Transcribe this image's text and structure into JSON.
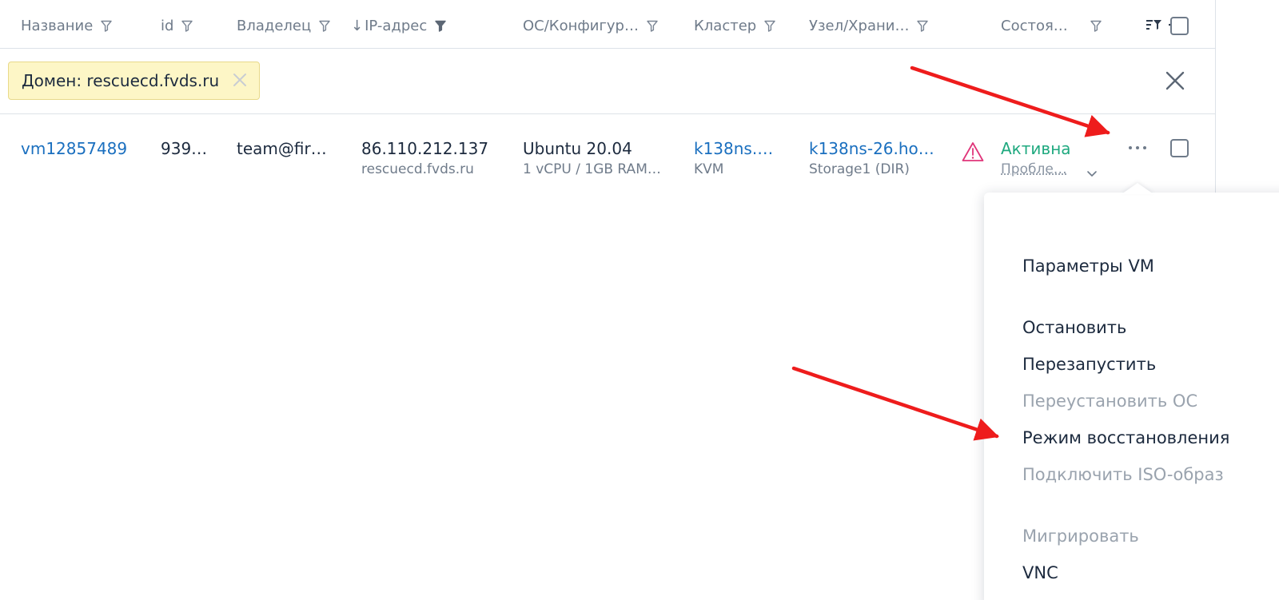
{
  "columns": [
    {
      "label": "Название"
    },
    {
      "label": "id"
    },
    {
      "label": "Владелец"
    },
    {
      "label": "IP-адрес",
      "sort": "↓"
    },
    {
      "label": "ОС/Конфигур…"
    },
    {
      "label": "Кластер"
    },
    {
      "label": "Узел/Храни…"
    },
    {
      "label": "Состоя…"
    }
  ],
  "filter": {
    "tag_label": "Домен: rescuecd.fvds.ru"
  },
  "row": {
    "name": "vm12857489",
    "id": "939…",
    "owner": "team@fir…",
    "ip": "86.110.212.137",
    "domain": "rescuecd.fvds.ru",
    "os": "Ubuntu 20.04",
    "config": "1 vCPU / 1GB RAM…",
    "cluster": "k138ns.…",
    "cluster_type": "KVM",
    "node": "k138ns-26.ho…",
    "storage": "Storage1 (DIR)",
    "status": "Активна",
    "status_sub": "Пробле…"
  },
  "menu": {
    "items": [
      {
        "label": "Параметры VM",
        "enabled": true
      },
      {
        "label": "Остановить",
        "enabled": true
      },
      {
        "label": "Перезапустить",
        "enabled": true
      },
      {
        "label": "Переустановить ОС",
        "enabled": false
      },
      {
        "label": "Режим восстановления",
        "enabled": true
      },
      {
        "label": "Подключить ISO-образ",
        "enabled": false
      },
      {
        "label": "Мигрировать",
        "enabled": false
      },
      {
        "label": "VNC",
        "enabled": true
      }
    ]
  },
  "colors": {
    "link": "#1a6fbf",
    "active": "#1fa97f",
    "warning": "#e0357a",
    "arrow": "#ee1c1c",
    "filter_tag_bg": "#fdf6c6"
  },
  "icons": {
    "column_filter": "funnel-outline-icon",
    "column_filter_active": "funnel-filled-icon",
    "filter_settings": "filter-list-icon",
    "settings": "gear-icon",
    "remove_tag": "close-icon",
    "clear_filters": "close-icon",
    "warning": "warning-triangle-icon",
    "more": "ellipsis-icon",
    "expand": "chevron-down-icon"
  }
}
